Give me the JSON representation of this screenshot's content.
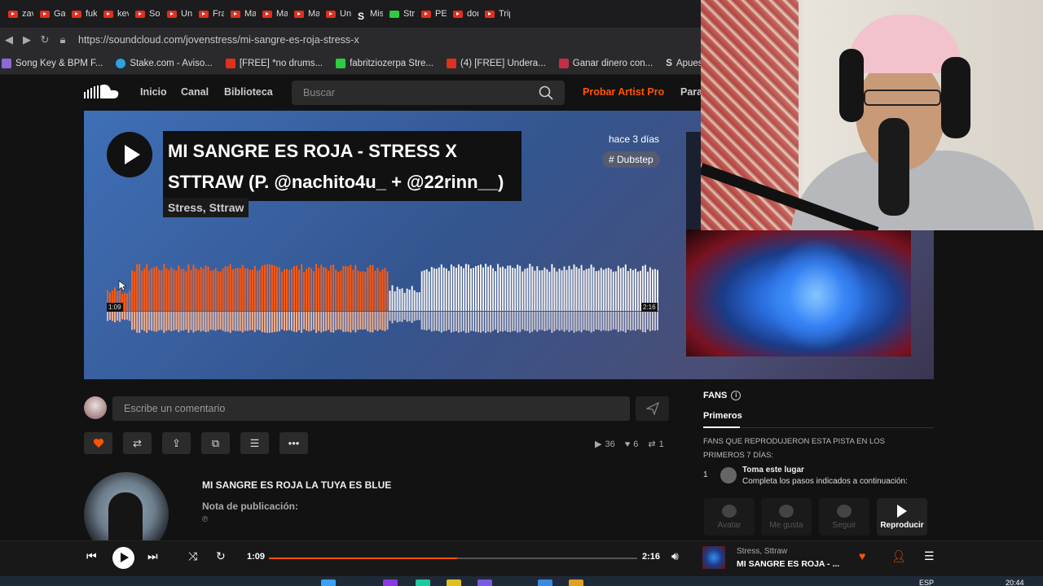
{
  "browser": {
    "tabs": [
      "zav",
      "Gal",
      "fuki",
      "kev",
      "Sou",
      "Unc",
      "Fra",
      "Mal",
      "Mal",
      "Mal",
      "Unc",
      "Mis",
      "Stre",
      "PEP",
      "don",
      "Trip"
    ],
    "url": "https://soundcloud.com/jovenstress/mi-sangre-es-roja-stress-x",
    "bookmarks": [
      "Song Key & BPM F...",
      "Stake.com - Aviso...",
      "[FREE] *no drums...",
      "fabritziozerpa Stre...",
      "(4) [FREE] Undera...",
      "Ganar dinero con...",
      "Apuestas"
    ]
  },
  "nav": {
    "home": "Inicio",
    "feed": "Canal",
    "library": "Biblioteca",
    "search_placeholder": "Buscar",
    "artist_pro": "Probar Artist Pro",
    "para": "Para"
  },
  "track": {
    "title_line1": "MI SANGRE ES ROJA - STRESS X",
    "title_line2": "STTRAW (P. @nachito4u_ + @22rinn__)",
    "artists": "Stress, Sttraw",
    "posted": "hace 3 días",
    "tag": "# Dubstep",
    "time_current": "1:09",
    "time_total": "2:16",
    "progress_fraction": 0.51
  },
  "comment": {
    "placeholder": "Escribe un comentario"
  },
  "stats": {
    "plays": "36",
    "likes": "6",
    "reposts": "1"
  },
  "description": {
    "text": "MI SANGRE ES ROJA LA TUYA ES BLUE",
    "release_note": "Nota de publicación:",
    "release_value": "℗"
  },
  "fans": {
    "heading": "FANS",
    "tab": "Primeros",
    "note": "FANS QUE REPRODUJERON ESTA PISTA EN LOS PRIMEROS 7 DÍAS:",
    "rank": "1",
    "name": "Toma este lugar",
    "sub": "Completa los pasos indicados a continuación:",
    "buttons": [
      "Avatar",
      "Me gusta",
      "Seguir",
      "Reproducir"
    ]
  },
  "player": {
    "current": "1:09",
    "total": "2:16",
    "artists": "Stress, Sttraw",
    "title": "MI SANGRE ES ROJA - ..."
  },
  "taskbar": {
    "lang": "ESP",
    "time": "20:44"
  },
  "colors": {
    "accent": "#ff5500",
    "background": "#121212",
    "hero_start": "#3f6fb6",
    "hero_end": "#3a3550"
  }
}
